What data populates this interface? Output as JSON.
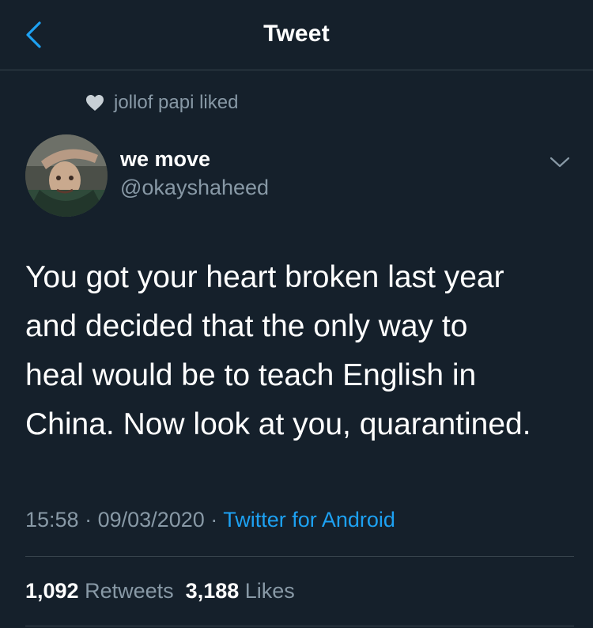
{
  "header": {
    "title": "Tweet"
  },
  "social_context": {
    "text": "jollof papi liked"
  },
  "author": {
    "display_name": "we move",
    "handle": "@okayshaheed"
  },
  "tweet": {
    "text": "You got your heart broken last year\nand decided that the only way to\nheal would be to teach English in\nChina. Now look at you, quarantined."
  },
  "meta": {
    "time": "15:58",
    "date": "09/03/2020",
    "separator": "·",
    "source": "Twitter for Android"
  },
  "stats": {
    "retweets_count": "1,092",
    "retweets_label": "Retweets",
    "likes_count": "3,188",
    "likes_label": "Likes"
  },
  "colors": {
    "background": "#15202b",
    "muted": "#8899a6",
    "accent": "#1da1f2",
    "divider": "#38444d"
  },
  "icons": {
    "back": "chevron-left-icon",
    "like_context": "heart-icon",
    "more": "chevron-down-icon"
  }
}
